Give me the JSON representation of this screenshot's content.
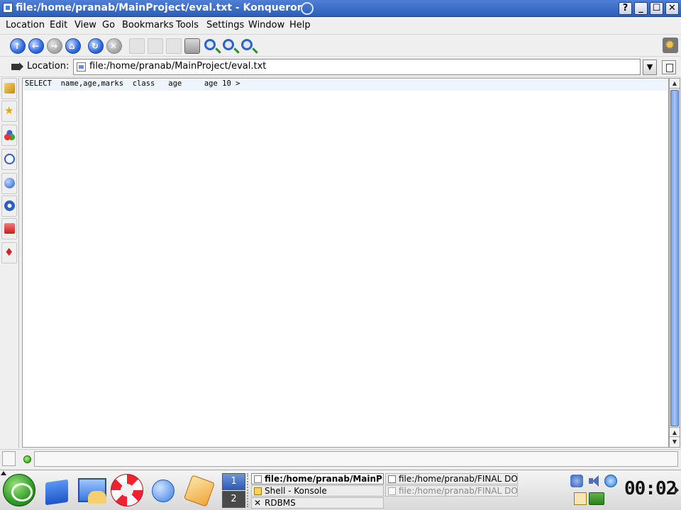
{
  "window": {
    "title": "file:/home/pranab/MainProject/eval.txt - Konqueror",
    "controls": {
      "help": "?",
      "minimize": "_",
      "maximize": "☐",
      "close": "✕"
    }
  },
  "menubar": {
    "items": [
      {
        "label": "Location"
      },
      {
        "label": "Edit"
      },
      {
        "label": "View"
      },
      {
        "label": "Go"
      },
      {
        "label": "Bookmarks"
      },
      {
        "label": "Tools"
      },
      {
        "label": "Settings"
      },
      {
        "label": "Window"
      },
      {
        "label": "Help"
      }
    ]
  },
  "toolbar": {
    "icons": [
      "up-icon",
      "back-icon",
      "forward-icon",
      "home-icon",
      "reload-icon",
      "stop-icon",
      "cut-icon",
      "copy-icon",
      "paste-icon",
      "print-icon",
      "zoom-in-icon",
      "zoom-out-icon",
      "find-icon"
    ]
  },
  "location_bar": {
    "label": "Location:",
    "value": "file:/home/pranab/MainProject/eval.txt"
  },
  "sidebar": {
    "tabs": [
      "configure-icon",
      "bookmarks-star-icon",
      "services-icon",
      "history-icon",
      "network-icon",
      "home-folder-icon",
      "root-folder-icon",
      "media-icon"
    ]
  },
  "content": {
    "text": "SELECT  name,age,marks  class   age     age 10 >"
  },
  "taskbar": {
    "launchers": [
      "kmenu-icon",
      "home-launcher-icon",
      "desktop-launcher-icon",
      "help-launcher-icon",
      "konqueror-launcher-icon",
      "kword-launcher-icon"
    ],
    "pager": [
      "1",
      "2"
    ],
    "tasks": [
      {
        "label": "file:/home/pranab/MainProject/eval.txt - Konqueror",
        "active": true
      },
      {
        "label": "Shell - Konsole",
        "active": false
      },
      {
        "label": "RDBMS",
        "active": false
      },
      {
        "label": "file:/home/pranab/FINAL DOC",
        "active": false
      },
      {
        "label": "file:/home/pranab/FINAL DOC",
        "active": false
      }
    ],
    "clock": "00:02"
  },
  "colors": {
    "titlebar": "#2c5fb9",
    "scrollbar_thumb": "#7c9fe0",
    "kmenu": "#2f9b24"
  }
}
